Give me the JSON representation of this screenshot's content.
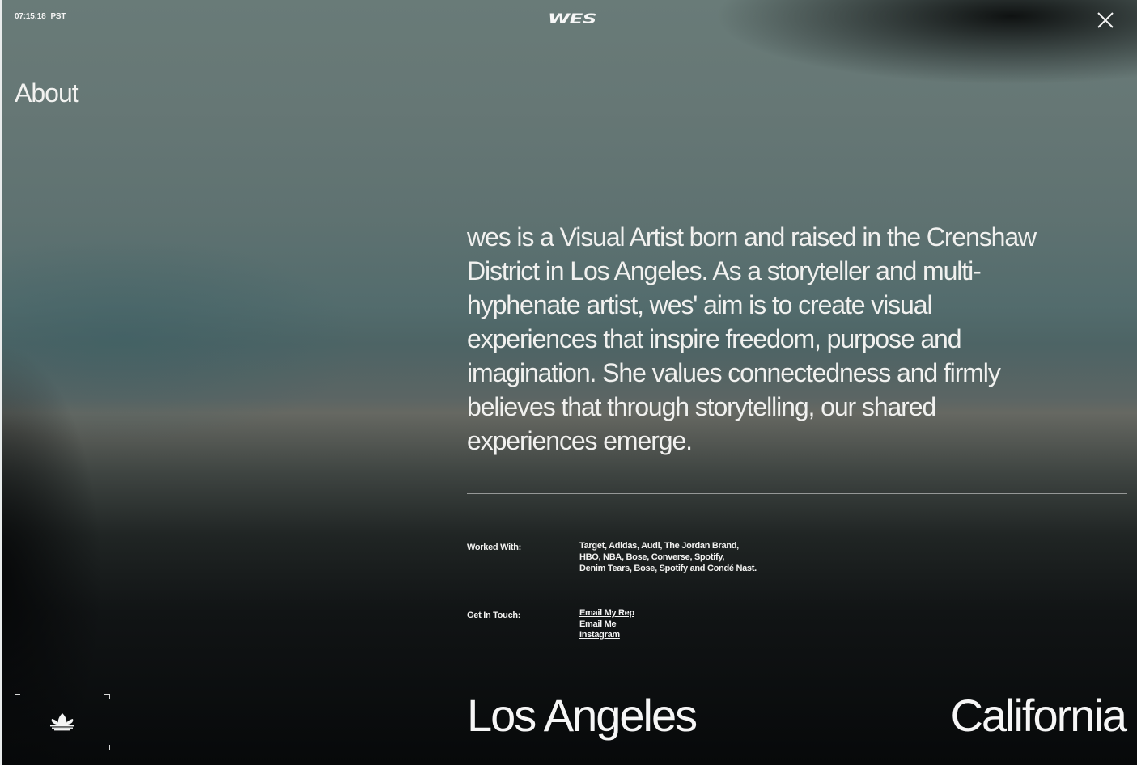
{
  "header": {
    "time": "07:15:18",
    "timezone": "PST",
    "logo": "WES",
    "close_icon": "close-icon"
  },
  "page": {
    "title": "About"
  },
  "bio": {
    "text": "wes is a Visual Artist born and raised in the Crenshaw District in Los Angeles. As a storyteller and multi-hyphenate artist, wes' aim is to create visual experiences that inspire freedom, purpose and imagination. She values connectedness and firmly believes that through storytelling, our shared experiences emerge."
  },
  "worked_with": {
    "label": "Worked With:",
    "lines": [
      "Target, Adidas, Audi, The Jordan Brand,",
      "HBO, NBA, Bose, Converse, Spotify,",
      "Denim Tears, Bose, Spotify and Condé Nast."
    ]
  },
  "contact": {
    "label": "Get In Touch:",
    "links": [
      "Email My Rep",
      "Email Me",
      "Instagram"
    ]
  },
  "location": {
    "city": "Los Angeles",
    "state": "California"
  },
  "badge": {
    "icon": "adidas-trefoil-icon"
  },
  "colors": {
    "text": "#f2f2f0",
    "background_top": "#697b78",
    "background_bottom": "#07090a"
  }
}
